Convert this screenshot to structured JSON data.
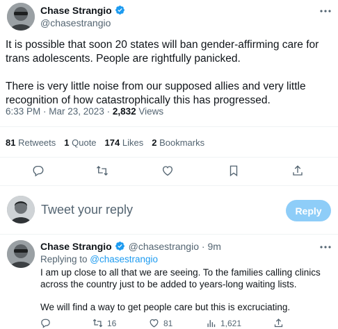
{
  "main_tweet": {
    "author_name": "Chase Strangio",
    "author_handle": "@chasestrangio",
    "text_p1": "It is possible that soon 20 states will ban gender-affirming care for trans adolescents. People are rightfully panicked.",
    "text_p2": "There is very little noise from our supposed allies and very little recognition of how catastrophically this has progressed.",
    "time": "6:33 PM · Mar 23, 2023 · ",
    "views_count": "2,832",
    "views_label": " Views"
  },
  "stats": {
    "retweets_count": "81",
    "retweets_label": " Retweets",
    "quotes_count": "1",
    "quotes_label": " Quote",
    "likes_count": "174",
    "likes_label": " Likes",
    "bookmarks_count": "2",
    "bookmarks_label": " Bookmarks"
  },
  "composer": {
    "placeholder": "Tweet your reply",
    "reply_button": "Reply"
  },
  "reply_tweet": {
    "author_name": "Chase Strangio",
    "author_handle": "@chasestrangio",
    "separator": " · ",
    "time": "9m",
    "replying_to_label": "Replying to ",
    "replying_to_handle": "@chasestrangio",
    "text_p1": "I am up close to all that we are seeing. To the families calling clinics across the country just to be added to years-long waiting lists.",
    "text_p2": "We will find a way to get people care but this is excruciating.",
    "retweets": "16",
    "likes": "81",
    "views": "1,621"
  },
  "icons": [
    "more-icon",
    "verified-icon",
    "reply-icon",
    "retweet-icon",
    "like-icon",
    "bookmark-icon",
    "share-icon",
    "views-icon"
  ],
  "colors": {
    "accent": "#1d9bf0",
    "reply_button_disabled": "#8ecdf8",
    "secondary_text": "#536471",
    "divider": "#eff3f4"
  }
}
